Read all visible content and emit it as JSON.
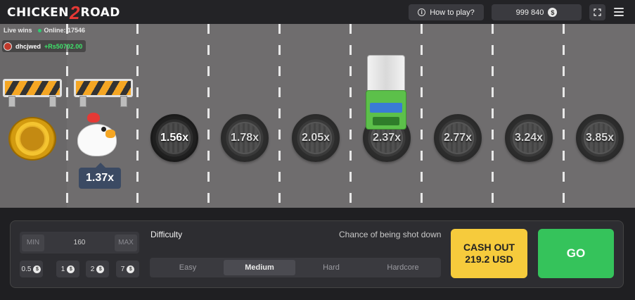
{
  "header": {
    "logo_left": "CHICKEN",
    "logo_num": "2",
    "logo_right": "ROAD",
    "help_label": "How to play?",
    "balance": "999 840",
    "currency_icon": "$"
  },
  "live": {
    "label": "Live wins",
    "online": "Online: 17546",
    "win_user": "dhcjwed",
    "win_amount": "+Rs50702.00"
  },
  "game": {
    "current_multiplier": "1.37x",
    "multipliers": [
      "1.56x",
      "1.78x",
      "2.05x",
      "2.37x",
      "2.77x",
      "3.24x",
      "3.85x"
    ]
  },
  "controls": {
    "min_label": "MIN",
    "max_label": "MAX",
    "bet_value": "160",
    "chips": [
      "0.5",
      "1",
      "2",
      "7"
    ],
    "difficulty_label": "Difficulty",
    "chance_label": "Chance of being shot down",
    "difficulty_options": [
      "Easy",
      "Medium",
      "Hard",
      "Hardcore"
    ],
    "difficulty_selected": "Medium",
    "cashout_line1": "CASH OUT",
    "cashout_line2": "219.2 USD",
    "go_label": "GO"
  },
  "colors": {
    "cashout": "#f6cb3c",
    "go": "#35c35b",
    "win_amount": "#3ee56b",
    "online_dot": "#2ecc71"
  }
}
